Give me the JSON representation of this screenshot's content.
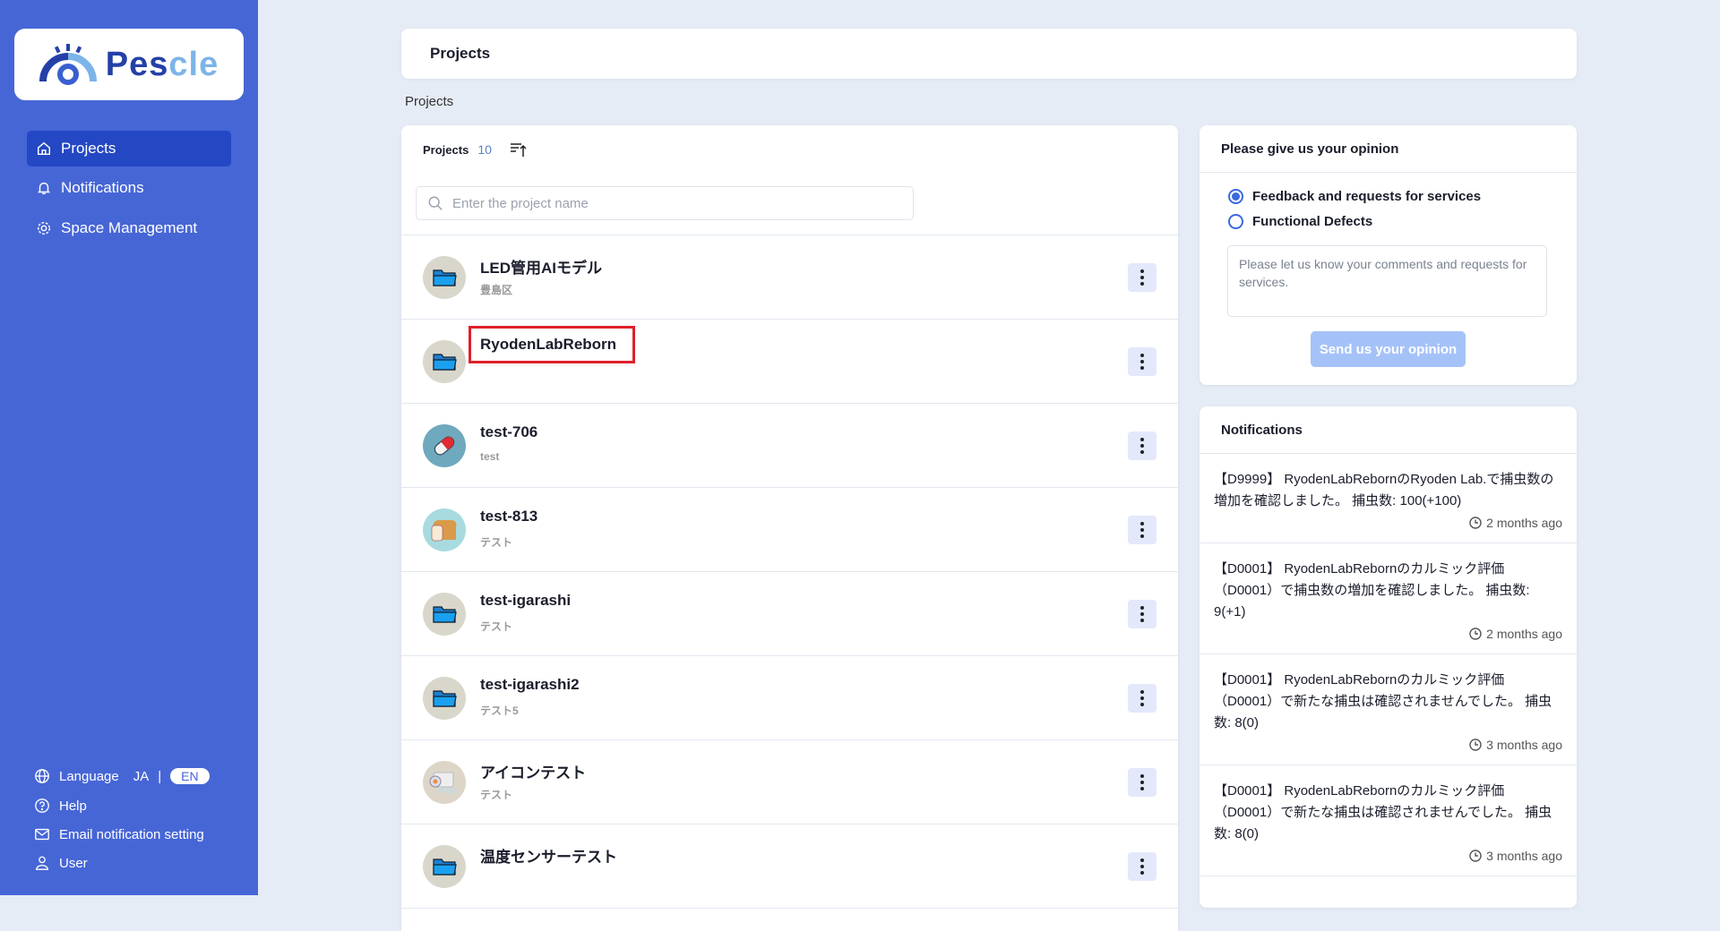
{
  "logo": {
    "text_a": "Pes",
    "text_b": "cle"
  },
  "sidebar": {
    "items": [
      {
        "label": "Projects",
        "icon": "home-icon"
      },
      {
        "label": "Notifications",
        "icon": "bell-icon"
      },
      {
        "label": "Space Management",
        "icon": "gear-icon"
      }
    ],
    "language_label": "Language",
    "lang_ja": "JA",
    "lang_sep": "|",
    "lang_en": "EN",
    "help": "Help",
    "email": "Email notification setting",
    "user": "User"
  },
  "header": {
    "title": "Projects"
  },
  "breadcrumb": "Projects",
  "projects": {
    "label": "Projects",
    "count": "10",
    "search_placeholder": "Enter the project name",
    "items": [
      {
        "name": "LED管用AIモデル",
        "sub": "豊島区",
        "avatar": "folder"
      },
      {
        "name": "RyodenLabReborn",
        "sub": "",
        "avatar": "folder"
      },
      {
        "name": "test-706",
        "sub": "test",
        "avatar": "pill"
      },
      {
        "name": "test-813",
        "sub": "テスト",
        "avatar": "bread"
      },
      {
        "name": "test-igarashi",
        "sub": "テスト",
        "avatar": "folder"
      },
      {
        "name": "test-igarashi2",
        "sub": "テスト5",
        "avatar": "folder"
      },
      {
        "name": "アイコンテスト",
        "sub": "テスト",
        "avatar": "roll"
      },
      {
        "name": "温度センサーテスト",
        "sub": "",
        "avatar": "folder"
      }
    ]
  },
  "opinion": {
    "title": "Please give us your opinion",
    "option1": "Feedback and requests for services",
    "option2": "Functional Defects",
    "placeholder": "Please let us know your comments and requests for services.",
    "send": "Send us your opinion"
  },
  "notifications": {
    "title": "Notifications",
    "items": [
      {
        "text": "【D9999】 RyodenLabRebornのRyoden Lab.で捕虫数の増加を確認しました。 捕虫数: 100(+100)",
        "ago": "2 months ago"
      },
      {
        "text": "【D0001】 RyodenLabRebornのカルミック評価（D0001）で捕虫数の増加を確認しました。 捕虫数: 9(+1)",
        "ago": "2 months ago"
      },
      {
        "text": "【D0001】 RyodenLabRebornのカルミック評価（D0001）で新たな捕虫は確認されませんでした。 捕虫数: 8(0)",
        "ago": "3 months ago"
      },
      {
        "text": "【D0001】 RyodenLabRebornのカルミック評価（D0001）で新たな捕虫は確認されませんでした。 捕虫数: 8(0)",
        "ago": "3 months ago"
      }
    ]
  }
}
